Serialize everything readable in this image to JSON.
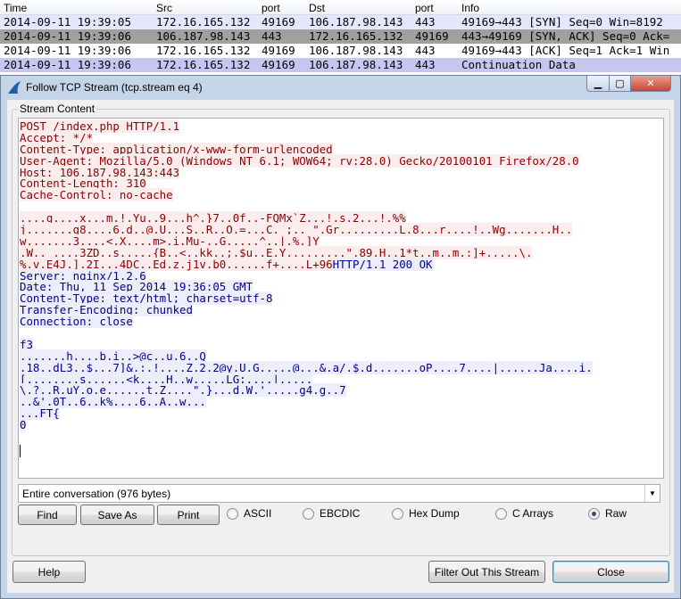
{
  "packet_list": {
    "headers": {
      "time": "Time",
      "src": "Src",
      "sport": "port",
      "dst": "Dst",
      "dport": "port",
      "info": "Info"
    },
    "rows": [
      {
        "time": "2014-09-11 19:39:05",
        "src": "172.16.165.132",
        "sport": "49169",
        "dst": "106.187.98.143",
        "dport": "443",
        "info": "49169→443 [SYN] Seq=0 Win=8192"
      },
      {
        "time": "2014-09-11 19:39:06",
        "src": "106.187.98.143",
        "sport": "443",
        "dst": "172.16.165.132",
        "dport": "49169",
        "info": "443→49169 [SYN, ACK] Seq=0 Ack="
      },
      {
        "time": "2014-09-11 19:39:06",
        "src": "172.16.165.132",
        "sport": "49169",
        "dst": "106.187.98.143",
        "dport": "443",
        "info": "49169→443 [ACK] Seq=1 Ack=1 Win"
      },
      {
        "time": "2014-09-11 19:39:06",
        "src": "172.16.165.132",
        "sport": "49169",
        "dst": "106.187.98.143",
        "dport": "443",
        "info": "Continuation Data"
      }
    ]
  },
  "dialog": {
    "title": "Follow TCP Stream (tcp.stream eq 4)",
    "group_label": "Stream Content",
    "stream_lines": [
      {
        "client": "POST /index.php HTTP/1.1",
        "server": ""
      },
      {
        "client": "Accept: */*",
        "server": ""
      },
      {
        "client": "Content-Type: application/x-www-form-urlencoded",
        "server": ""
      },
      {
        "client": "User-Agent: Mozilla/5.0 (Windows NT 6.1; WOW64; rv:28.0) Gecko/20100101 Firefox/28.0",
        "server": ""
      },
      {
        "client": "Host: 106.187.98.143:443",
        "server": ""
      },
      {
        "client": "Content-Length: 310",
        "server": ""
      },
      {
        "client": "Cache-Control: no-cache",
        "server": ""
      },
      {
        "client": "",
        "server": ""
      },
      {
        "client": "....g....x...m.!.Yu..9...h^.}7..0f..-FQMx`Z...!.s.2...!.%%",
        "server": ""
      },
      {
        "client": "j.......g8....6.d..@.U...S..R..O.=...C. ;.. \".Gr.........L.8...r....!..Wg.......H..",
        "server": ""
      },
      {
        "client": "w.......3....<.X....m>.i.Mu-..G.....^..|.%.]Y",
        "server": ""
      },
      {
        "client": ".W.. ....3ZD..s.....{B..<..kk..;.$u..E.Y.........\".89.H..1*t..m..m.:]+.....\\.",
        "server": ""
      },
      {
        "client": "%.v.E4J.].2I...4DC..Ed.z.j1v.b0......f+....L+96",
        "server": "HTTP/1.1 200 OK"
      },
      {
        "client": "",
        "server": "Server: nginx/1.2.6"
      },
      {
        "client": "",
        "server": "Date: Thu, 11 Sep 2014 19:36:05 GMT"
      },
      {
        "client": "",
        "server": "Content-Type: text/html; charset=utf-8"
      },
      {
        "client": "",
        "server": "Transfer-Encoding: chunked"
      },
      {
        "client": "",
        "server": "Connection: close"
      },
      {
        "client": "",
        "server": ""
      },
      {
        "client": "",
        "server": "f3"
      },
      {
        "client": "",
        "server": ".......h....b.i..>@c..u.6..Q"
      },
      {
        "client": "",
        "server": ".18..dL3..$...7]&.:.!....Z.2.2@y.U.G.....@...&.a/.$.d.......oP....7....|......Ja....i."
      },
      {
        "client": "",
        "server": "[........s......<k....H..w.....LG;....|....."
      },
      {
        "client": "",
        "server": "\\.?..R.uY.o.e......t.Z....\".}...d.W.'.....g4.g..7"
      },
      {
        "client": "",
        "server": "..&'.0T..6..k%....6..A..w..."
      },
      {
        "client": "",
        "server": "...FT{"
      },
      {
        "client": "",
        "server": "0"
      }
    ],
    "conversation_select": "Entire conversation (976 bytes)",
    "buttons": {
      "find": "Find",
      "save_as": "Save As",
      "print": "Print",
      "help": "Help",
      "filter_out": "Filter Out This Stream",
      "close": "Close"
    },
    "radios": [
      {
        "label": "ASCII",
        "checked": false
      },
      {
        "label": "EBCDIC",
        "checked": false
      },
      {
        "label": "Hex Dump",
        "checked": false
      },
      {
        "label": "C Arrays",
        "checked": false
      },
      {
        "label": "Raw",
        "checked": true
      }
    ]
  }
}
